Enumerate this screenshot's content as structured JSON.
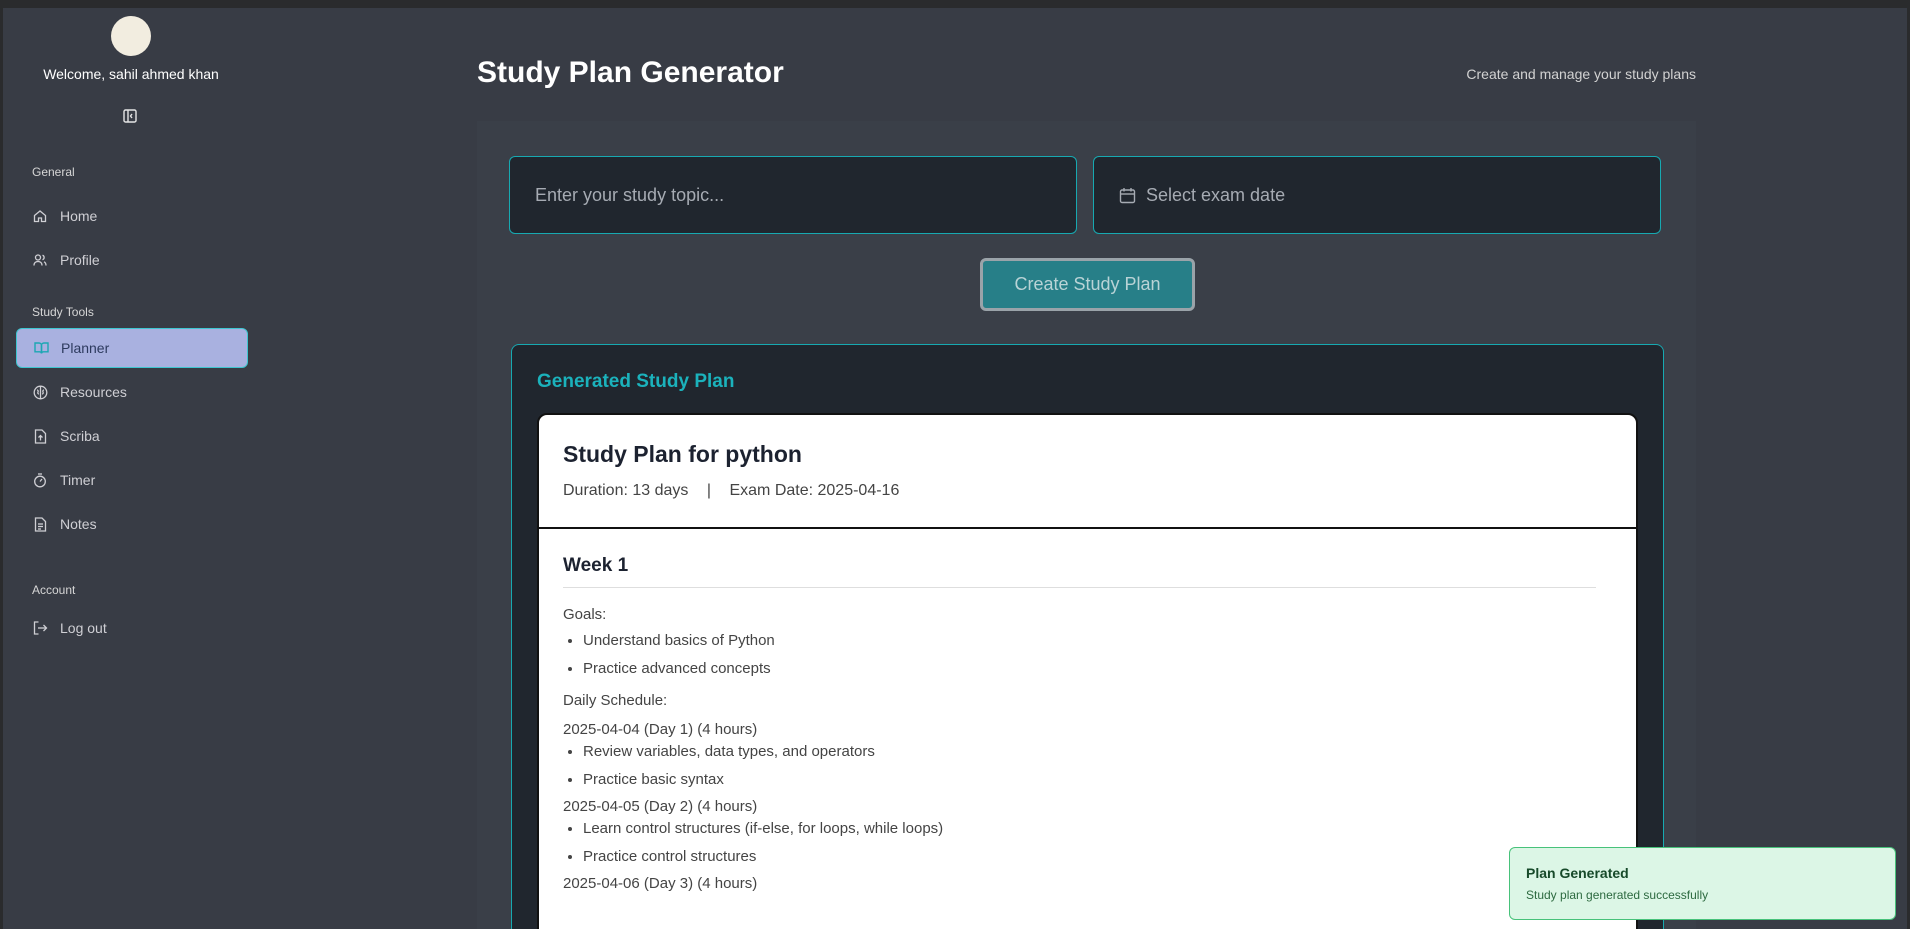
{
  "user": {
    "welcome": "Welcome, sahil ahmed khan"
  },
  "sidebar": {
    "sections": [
      {
        "label": "General",
        "items": [
          {
            "label": "Home",
            "icon": "home-icon"
          },
          {
            "label": "Profile",
            "icon": "users-icon"
          }
        ]
      },
      {
        "label": "Study Tools",
        "items": [
          {
            "label": "Planner",
            "icon": "book-open-icon",
            "active": true
          },
          {
            "label": "Resources",
            "icon": "brain-icon"
          },
          {
            "label": "Scriba",
            "icon": "file-upload-icon"
          },
          {
            "label": "Timer",
            "icon": "stopwatch-icon"
          },
          {
            "label": "Notes",
            "icon": "file-text-icon"
          }
        ]
      },
      {
        "label": "Account",
        "items": [
          {
            "label": "Log out",
            "icon": "logout-icon"
          }
        ]
      }
    ]
  },
  "header": {
    "title": "Study Plan Generator",
    "subtitle": "Create and manage your study plans"
  },
  "form": {
    "topic_placeholder": "Enter your study topic...",
    "date_placeholder": "Select exam date",
    "create_label": "Create Study Plan"
  },
  "result": {
    "heading": "Generated Study Plan",
    "plan_title": "Study Plan for python",
    "duration": "Duration: 13 days",
    "separator": "|",
    "exam_date": "Exam Date: 2025-04-16",
    "week_title": "Week 1",
    "goals_label": "Goals:",
    "goals": [
      "Understand basics of Python",
      "Practice advanced concepts"
    ],
    "schedule_label": "Daily Schedule:",
    "days": [
      {
        "label": "2025-04-04 (Day 1) (4 hours)",
        "tasks": [
          "Review variables, data types, and operators",
          "Practice basic syntax"
        ]
      },
      {
        "label": "2025-04-05 (Day 2) (4 hours)",
        "tasks": [
          "Learn control structures (if-else, for loops, while loops)",
          "Practice control structures"
        ]
      },
      {
        "label": "2025-04-06 (Day 3) (4 hours)",
        "tasks": []
      }
    ]
  },
  "toast": {
    "title": "Plan Generated",
    "message": "Study plan generated successfully"
  },
  "colors": {
    "accent": "#17a9b1",
    "active_nav": "#a9b1e0",
    "toast_bg": "#dcf6e6"
  }
}
